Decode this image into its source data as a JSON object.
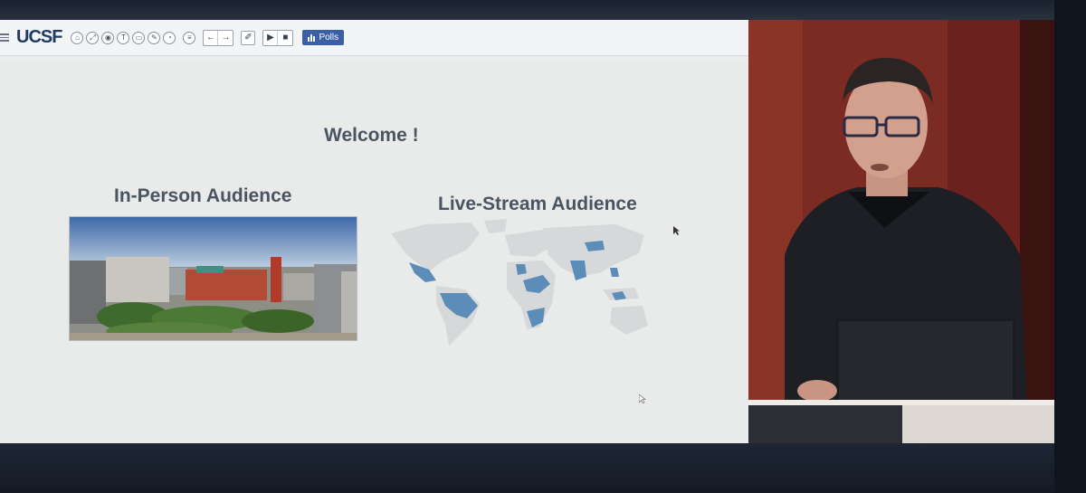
{
  "app": {
    "logo": "UCSF",
    "polls_label": "Polls"
  },
  "toolbar": {
    "circle_tools": [
      "home-icon",
      "expand-icon",
      "camera-icon",
      "text-icon",
      "screen-icon",
      "pen-icon",
      "clock-icon"
    ],
    "list_tool": "list-icon",
    "nav": [
      "arrow-left-icon",
      "arrow-right-icon"
    ],
    "edit_tool": "pencil-icon",
    "media": [
      "video-icon",
      "stop-icon"
    ]
  },
  "slide": {
    "title": "Welcome !",
    "left_heading": "In-Person Audience",
    "right_heading": "Live-Stream Audience"
  },
  "colors": {
    "accent": "#3a5fa5",
    "map_highlight": "#5b8db8",
    "map_base": "#d6d8da",
    "slide_text": "#4a5561"
  }
}
